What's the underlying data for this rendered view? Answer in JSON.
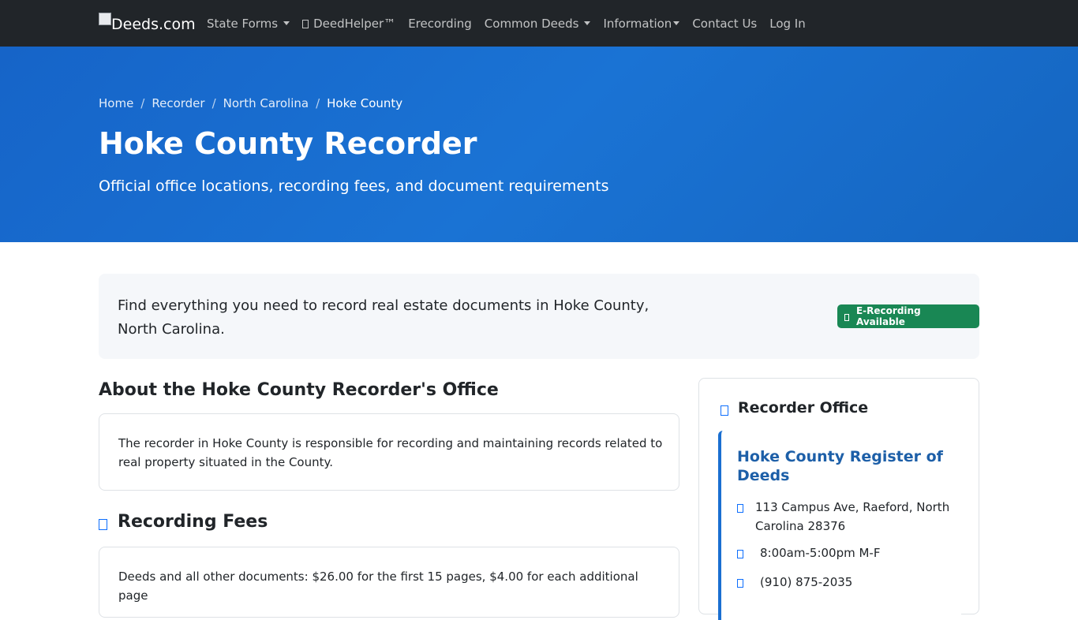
{
  "navbar": {
    "brand": "Deeds.com",
    "items": [
      {
        "label": "State Forms",
        "dropdown": true
      },
      {
        "label": "DeedHelper™",
        "icon": "deedhelper-icon",
        "dropdown": false
      },
      {
        "label": "Erecording",
        "dropdown": false
      },
      {
        "label": "Common Deeds",
        "dropdown": true
      },
      {
        "label": "Information",
        "dropdown": true
      },
      {
        "label": "Contact Us",
        "dropdown": false
      },
      {
        "label": "Log In",
        "dropdown": false
      }
    ]
  },
  "breadcrumb": [
    "Home",
    "Recorder",
    "North Carolina",
    "Hoke County"
  ],
  "hero": {
    "title": "Hoke County Recorder",
    "subtitle": "Official office locations, recording fees, and document requirements"
  },
  "intro": {
    "text": "Find everything you need to record real estate documents in Hoke County, North Carolina.",
    "badge": "E-Recording Available"
  },
  "about": {
    "title": "About the Hoke County Recorder's Office",
    "text": "The recorder in Hoke County is responsible for recording and maintaining records related to real property situated in the County."
  },
  "fees": {
    "title": "Recording Fees",
    "text": "Deeds and all other documents: $26.00 for the first 15 pages, $4.00 for each additional page"
  },
  "sidebar": {
    "header": "Recorder Office",
    "office_name": "Hoke County Register of Deeds",
    "address": "113 Campus Ave, Raeford, North Carolina 28376",
    "hours": "8:00am-5:00pm M-F",
    "phone": "(910) 875-2035"
  },
  "colors": {
    "navbar_bg": "#212529",
    "hero_bg": "#1a6fd1",
    "badge_bg": "#198754",
    "accent": "#0d6efd",
    "office_name": "#1d5fa8"
  }
}
